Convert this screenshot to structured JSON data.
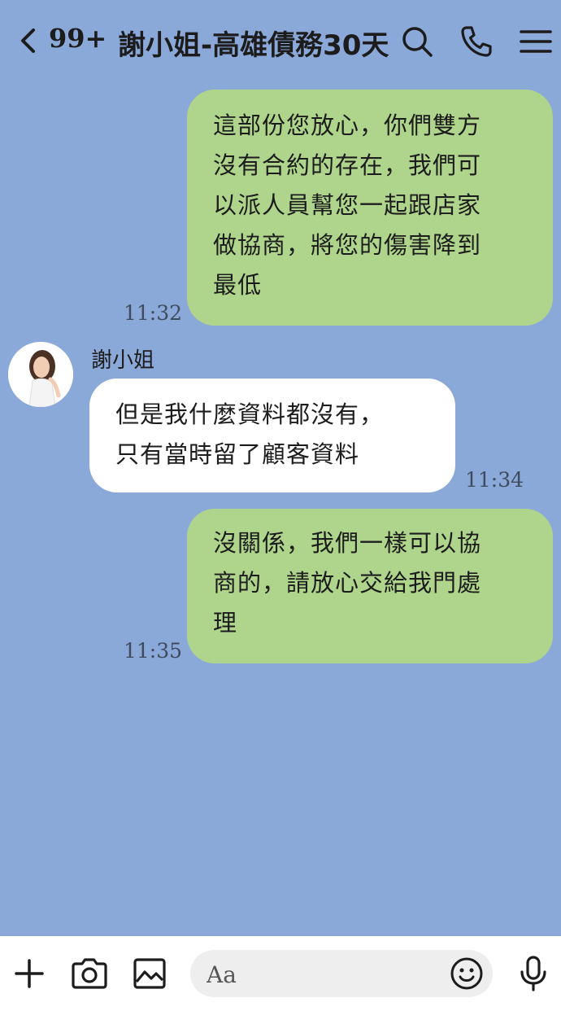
{
  "header": {
    "unread_count": "99+",
    "title": "謝小姐-高雄債務30天"
  },
  "messages": [
    {
      "side": "sent",
      "text": "這部份您放心，你們雙方沒有合約的存在，我們可以派人員幫您一起跟店家做協商，將您的傷害降到最低",
      "lines": [
        "這部份您放心，你們雙方",
        "沒有合約的存在，我們可",
        "以派人員幫您一起跟店家",
        "做協商，將您的傷害降到",
        "最低"
      ],
      "time": "11:32"
    },
    {
      "side": "received",
      "sender": "謝小姐",
      "text": "但是我什麼資料都沒有，只有當時留了顧客資料",
      "lines": [
        "但是我什麼資料都沒有，",
        "只有當時留了顧客資料"
      ],
      "time": "11:34"
    },
    {
      "side": "sent",
      "text": "沒關係，我們一樣可以協商的，請放心交給我們處理",
      "lines": [
        "沒關係，我們一樣可以協",
        "商的，請放心交給我門處",
        "理"
      ],
      "time": "11:35"
    }
  ],
  "input": {
    "placeholder": "Aa"
  },
  "icons": {
    "back": "chevron-left-icon",
    "search": "search-icon",
    "call": "phone-icon",
    "menu": "menu-icon",
    "add": "plus-icon",
    "camera": "camera-icon",
    "image": "image-icon",
    "emoji": "emoji-icon",
    "voice": "microphone-icon"
  },
  "colors": {
    "background": "#8aa8d8",
    "sent_bubble": "#afd58c",
    "received_bubble": "#ffffff"
  }
}
